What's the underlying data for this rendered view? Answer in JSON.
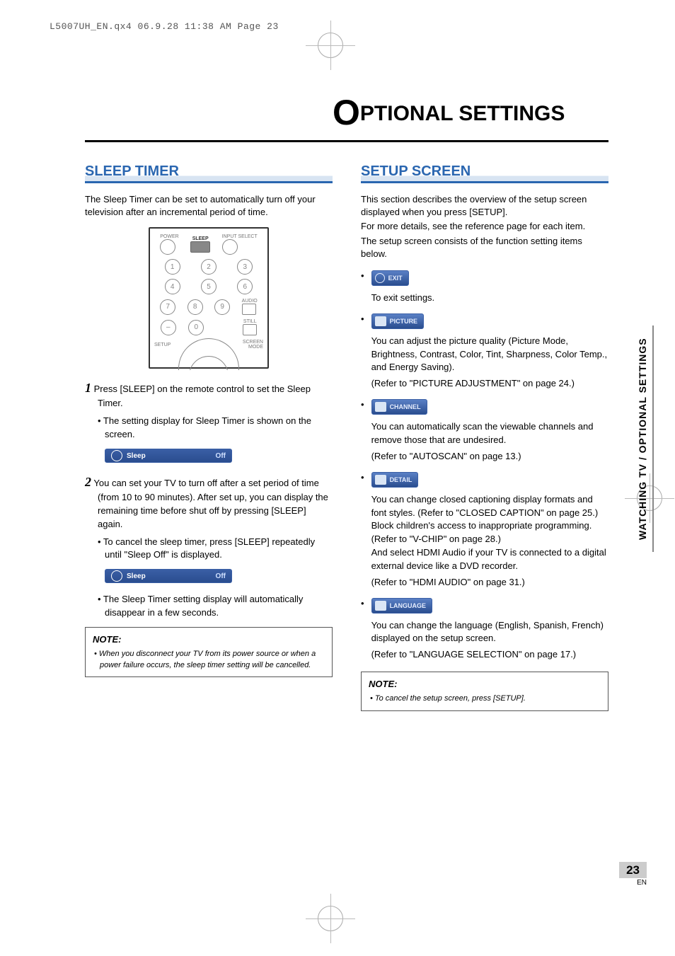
{
  "print_header": "L5007UH_EN.qx4  06.9.28  11:38 AM  Page 23",
  "page_title_letter": "O",
  "page_title_rest": "PTIONAL SETTINGS",
  "side_tab": "WATCHING TV / OPTIONAL SETTINGS",
  "page_number": "23",
  "page_lang": "EN",
  "left": {
    "heading": "SLEEP TIMER",
    "intro": "The Sleep Timer can be set to automatically turn off your television after an incremental period of time.",
    "remote": {
      "power": "POWER",
      "sleep": "SLEEP",
      "input": "INPUT SELECT",
      "audio": "AUDIO",
      "still": "STILL",
      "setup": "SETUP",
      "screen": "SCREEN MODE",
      "keys": [
        "1",
        "2",
        "3",
        "4",
        "5",
        "6",
        "7",
        "8",
        "9",
        "–",
        "0"
      ]
    },
    "step1_num": "1",
    "step1": "Press [SLEEP] on the remote control to set the Sleep Timer.",
    "step1_sub": "• The setting display for Sleep Timer is shown on the screen.",
    "osd1_label": "Sleep",
    "osd1_val": "Off",
    "step2_num": "2",
    "step2": "You can set your TV to turn off after a set period of time (from 10 to 90 minutes). After set up, you can display the remaining time before shut off by pressing [SLEEP] again.",
    "step2_sub1": "• To cancel the sleep timer, press [SLEEP] repeatedly until \"Sleep Off\" is displayed.",
    "osd2_label": "Sleep",
    "osd2_val": "Off",
    "step2_sub2": "• The Sleep Timer setting display will automatically disappear in a few seconds.",
    "note_title": "NOTE:",
    "note_item": "• When you disconnect your TV from its power source or when a power failure occurs, the sleep timer setting will be cancelled."
  },
  "right": {
    "heading": "SETUP SCREEN",
    "intro1": "This section describes the overview of the setup screen displayed when you press [SETUP].",
    "intro2": "For more details, see the reference page for each item.",
    "intro3": "The setup screen consists of the function setting items below.",
    "items": [
      {
        "pill": "EXIT",
        "desc": "To exit settings."
      },
      {
        "pill": "PICTURE",
        "desc": "You can adjust the picture quality (Picture Mode, Brightness, Contrast, Color, Tint, Sharpness, Color Temp., and Energy Saving).",
        "ref": "(Refer to \"PICTURE ADJUSTMENT\" on page 24.)"
      },
      {
        "pill": "CHANNEL",
        "desc": "You can automatically scan the viewable channels and remove those that are undesired.",
        "ref": "(Refer to \"AUTOSCAN\" on page 13.)"
      },
      {
        "pill": "DETAIL",
        "desc": "You can change closed captioning display formats and font styles. (Refer to \"CLOSED CAPTION\" on page 25.)\nBlock children's access to inappropriate programming. (Refer to \"V-CHIP\" on page 28.)\nAnd select HDMI Audio if your TV is connected to a digital external device like a DVD recorder.",
        "ref": "(Refer to \"HDMI AUDIO\" on page 31.)"
      },
      {
        "pill": "LANGUAGE",
        "desc": "You can change the language (English, Spanish, French) displayed on the setup screen.",
        "ref": "(Refer to \"LANGUAGE SELECTION\" on page 17.)"
      }
    ],
    "note_title": "NOTE:",
    "note_item": "• To cancel the setup screen, press [SETUP]."
  }
}
